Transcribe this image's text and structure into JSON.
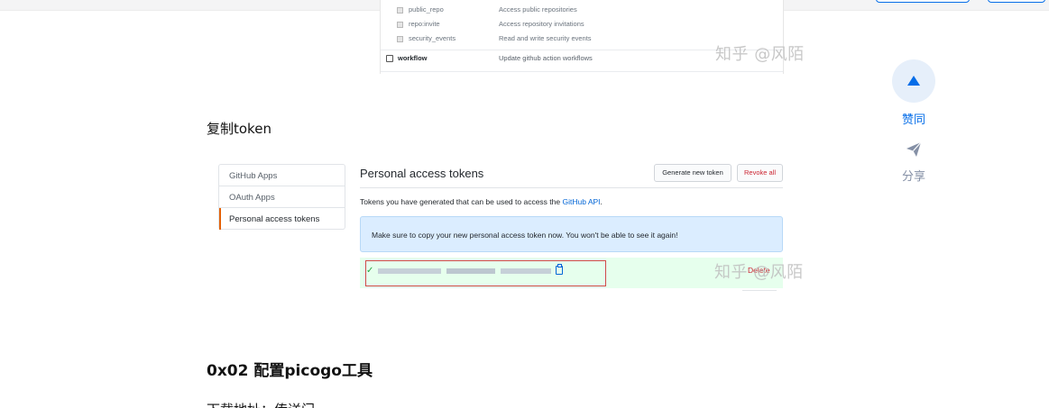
{
  "scopes": [
    {
      "name": "public_repo",
      "desc": "Access public repositories"
    },
    {
      "name": "repo:invite",
      "desc": "Access repository invitations"
    },
    {
      "name": "security_events",
      "desc": "Read and write security events"
    }
  ],
  "workflow_scope": {
    "name": "workflow",
    "desc": "Update github action workflows"
  },
  "watermark": "知乎 @风陌",
  "copy_token_text": "复制token",
  "github": {
    "sidebar": [
      "GitHub Apps",
      "OAuth Apps",
      "Personal access tokens"
    ],
    "title": "Personal access tokens",
    "generate_label": "Generate new token",
    "revoke_label": "Revoke all",
    "desc_prefix": "Tokens you have generated that can be used to access the ",
    "desc_link": "GitHub API",
    "desc_suffix": ".",
    "flash": "Make sure to copy your new personal access token now. You won't be able to see it again!",
    "delete_label": "Delete"
  },
  "section_heading": "0x02 配置picogo工具",
  "cut_text": "下载地址：传送门",
  "actions": {
    "vote_label": "赞同",
    "share_label": "分享",
    "accent": "#056de8"
  }
}
